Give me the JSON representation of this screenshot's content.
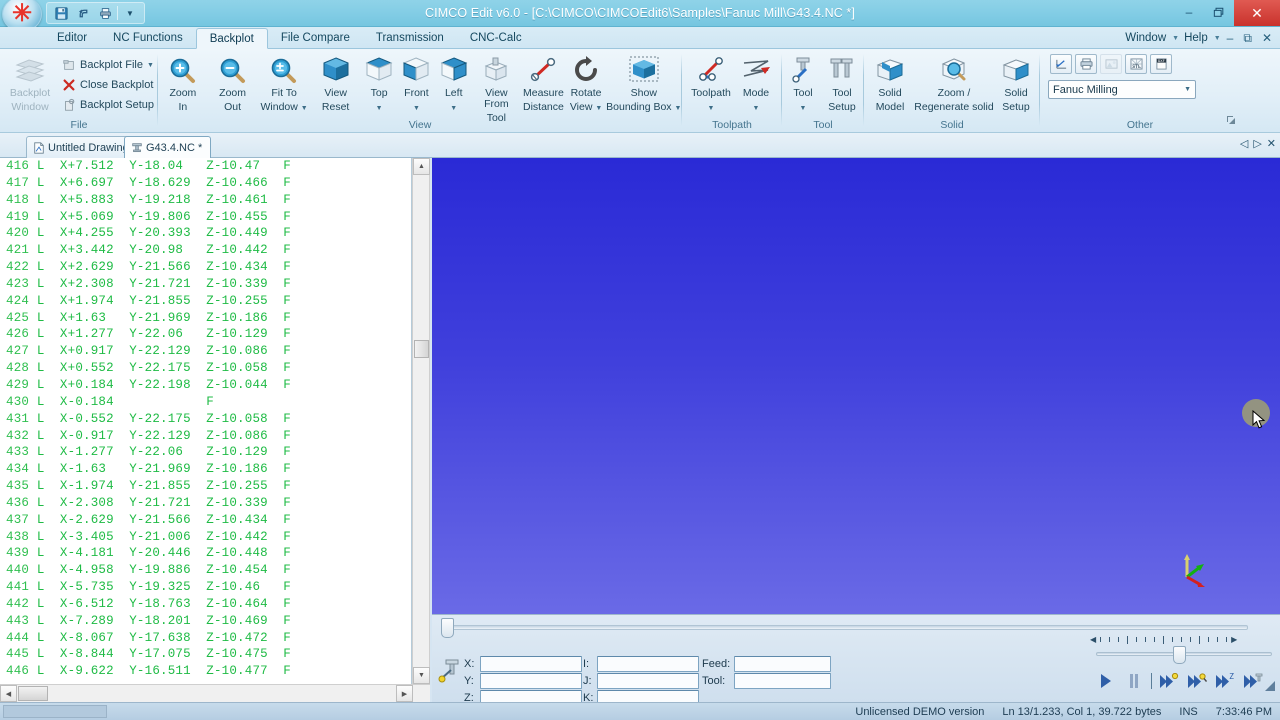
{
  "window": {
    "title": "CIMCO Edit v6.0 - [C:\\CIMCO\\CIMCOEdit6\\Samples\\Fanuc Mill\\G43.4.NC *]",
    "minimize": "–",
    "restore": "❐",
    "close": "✕",
    "quick_access": [
      "save-icon",
      "undo-icon",
      "print-icon",
      "customize-icon"
    ]
  },
  "ribbon_tabs": {
    "items": [
      {
        "label": "Editor",
        "active": false
      },
      {
        "label": "NC Functions",
        "active": false
      },
      {
        "label": "Backplot",
        "active": true
      },
      {
        "label": "File Compare",
        "active": false
      },
      {
        "label": "Transmission",
        "active": false
      },
      {
        "label": "CNC-Calc",
        "active": false
      }
    ],
    "right_menus": [
      {
        "label": "Window"
      },
      {
        "label": "Help"
      }
    ],
    "right_icons": [
      "minimize-icon",
      "restore-icon",
      "close-icon"
    ]
  },
  "ribbon": {
    "groups": [
      {
        "name": "File",
        "label": "File",
        "big": [
          {
            "label1": "Backplot",
            "label2": "Window",
            "icon": "backplot-window-icon",
            "disabled": true
          }
        ],
        "small": [
          {
            "label": "Backplot File",
            "icon": "backplot-file-icon",
            "has_caret": true
          },
          {
            "label": "Close Backplot",
            "icon": "close-backplot-icon",
            "has_caret": false
          },
          {
            "label": "Backplot Setup",
            "icon": "backplot-setup-icon",
            "has_caret": false
          }
        ]
      },
      {
        "name": "View",
        "label": "View",
        "big": [
          {
            "label1": "Zoom",
            "label2": "In",
            "icon": "zoom-in-icon"
          },
          {
            "label1": "Zoom",
            "label2": "Out",
            "icon": "zoom-out-icon"
          },
          {
            "label1": "Fit To",
            "label2": "Window",
            "icon": "fit-to-window-icon",
            "has_caret": true
          },
          {
            "label1": "View",
            "label2": "Reset",
            "icon": "view-reset-icon"
          },
          {
            "label1": "Top",
            "label2": "",
            "icon": "top-view-icon",
            "has_caret": true
          },
          {
            "label1": "Front",
            "label2": "",
            "icon": "front-view-icon",
            "has_caret": true
          },
          {
            "label1": "Left",
            "label2": "",
            "icon": "left-view-icon",
            "has_caret": true
          },
          {
            "label1": "View From",
            "label2": "Tool",
            "icon": "view-from-tool-icon"
          },
          {
            "label1": "Measure",
            "label2": "Distance",
            "icon": "measure-distance-icon"
          },
          {
            "label1": "Rotate",
            "label2": "View",
            "icon": "rotate-view-icon",
            "has_caret": true
          },
          {
            "label1": "Show",
            "label2": "Bounding Box",
            "icon": "show-bounding-box-icon",
            "has_caret": true
          }
        ]
      },
      {
        "name": "Toolpath",
        "label": "Toolpath",
        "big": [
          {
            "label1": "Toolpath",
            "label2": "",
            "icon": "toolpath-icon",
            "has_caret": true
          },
          {
            "label1": "Mode",
            "label2": "",
            "icon": "mode-icon",
            "has_caret": true
          }
        ]
      },
      {
        "name": "Tool",
        "label": "Tool",
        "big": [
          {
            "label1": "Tool",
            "label2": "",
            "icon": "tool-icon",
            "has_caret": true
          },
          {
            "label1": "Tool",
            "label2": "Setup",
            "icon": "tool-setup-icon"
          }
        ]
      },
      {
        "name": "Solid",
        "label": "Solid",
        "big": [
          {
            "label1": "Solid",
            "label2": "Model",
            "icon": "solid-model-icon"
          },
          {
            "label1": "Zoom /",
            "label2": "Regenerate solid",
            "icon": "zoom-regenerate-solid-icon"
          },
          {
            "label1": "Solid",
            "label2": "Setup",
            "icon": "solid-setup-icon"
          }
        ]
      },
      {
        "name": "Other",
        "label": "Other",
        "icons": [
          "export-plot-icon",
          "print-plot-icon",
          "snapshot-icon",
          "stl-export-icon",
          "dxf-export-icon"
        ],
        "machine_select": "Fanuc Milling",
        "dialog_launcher": "dialog-launcher-icon"
      }
    ]
  },
  "doc_tabs": {
    "items": [
      {
        "label": "Untitled Drawing",
        "icon": "drawing-icon",
        "active": false
      },
      {
        "label": "G43.4.NC *",
        "icon": "nc-file-icon",
        "active": true
      }
    ],
    "nav": [
      "◁",
      "▷",
      "✕"
    ]
  },
  "editor": {
    "lines": [
      {
        "no": "416",
        "code": "L  X+7.512  Y-18.04   Z-10.47   F"
      },
      {
        "no": "417",
        "code": "L  X+6.697  Y-18.629  Z-10.466  F"
      },
      {
        "no": "418",
        "code": "L  X+5.883  Y-19.218  Z-10.461  F"
      },
      {
        "no": "419",
        "code": "L  X+5.069  Y-19.806  Z-10.455  F"
      },
      {
        "no": "420",
        "code": "L  X+4.255  Y-20.393  Z-10.449  F"
      },
      {
        "no": "421",
        "code": "L  X+3.442  Y-20.98   Z-10.442  F"
      },
      {
        "no": "422",
        "code": "L  X+2.629  Y-21.566  Z-10.434  F"
      },
      {
        "no": "423",
        "code": "L  X+2.308  Y-21.721  Z-10.339  F"
      },
      {
        "no": "424",
        "code": "L  X+1.974  Y-21.855  Z-10.255  F"
      },
      {
        "no": "425",
        "code": "L  X+1.63   Y-21.969  Z-10.186  F"
      },
      {
        "no": "426",
        "code": "L  X+1.277  Y-22.06   Z-10.129  F"
      },
      {
        "no": "427",
        "code": "L  X+0.917  Y-22.129  Z-10.086  F"
      },
      {
        "no": "428",
        "code": "L  X+0.552  Y-22.175  Z-10.058  F"
      },
      {
        "no": "429",
        "code": "L  X+0.184  Y-22.198  Z-10.044  F"
      },
      {
        "no": "430",
        "code": "L  X-0.184            F"
      },
      {
        "no": "431",
        "code": "L  X-0.552  Y-22.175  Z-10.058  F"
      },
      {
        "no": "432",
        "code": "L  X-0.917  Y-22.129  Z-10.086  F"
      },
      {
        "no": "433",
        "code": "L  X-1.277  Y-22.06   Z-10.129  F"
      },
      {
        "no": "434",
        "code": "L  X-1.63   Y-21.969  Z-10.186  F"
      },
      {
        "no": "435",
        "code": "L  X-1.974  Y-21.855  Z-10.255  F"
      },
      {
        "no": "436",
        "code": "L  X-2.308  Y-21.721  Z-10.339  F"
      },
      {
        "no": "437",
        "code": "L  X-2.629  Y-21.566  Z-10.434  F"
      },
      {
        "no": "438",
        "code": "L  X-3.405  Y-21.006  Z-10.442  F"
      },
      {
        "no": "439",
        "code": "L  X-4.181  Y-20.446  Z-10.448  F"
      },
      {
        "no": "440",
        "code": "L  X-4.958  Y-19.886  Z-10.454  F"
      },
      {
        "no": "441",
        "code": "L  X-5.735  Y-19.325  Z-10.46   F"
      },
      {
        "no": "442",
        "code": "L  X-6.512  Y-18.763  Z-10.464  F"
      },
      {
        "no": "443",
        "code": "L  X-7.289  Y-18.201  Z-10.469  F"
      },
      {
        "no": "444",
        "code": "L  X-8.067  Y-17.638  Z-10.472  F"
      },
      {
        "no": "445",
        "code": "L  X-8.844  Y-17.075  Z-10.475  F"
      },
      {
        "no": "446",
        "code": "L  X-9.622  Y-16.511  Z-10.477  F"
      }
    ],
    "text_color": "#1fbb45",
    "background": "#ffffff"
  },
  "viewport": {
    "gradient_top": "#2a2ad6",
    "gradient_bottom": "#6a6ae6",
    "tool_marker_color": "#9a9a78",
    "axis_x_color": "#d42020",
    "axis_y_color": "#14b014",
    "axis_z_color": "#d8d070"
  },
  "control_panel": {
    "fields": [
      {
        "label": "X:",
        "value": "",
        "name": "x-field"
      },
      {
        "label": "Y:",
        "value": "",
        "name": "y-field"
      },
      {
        "label": "Z:",
        "value": "",
        "name": "z-field"
      },
      {
        "label": "I:",
        "value": "",
        "name": "i-field"
      },
      {
        "label": "J:",
        "value": "",
        "name": "j-field"
      },
      {
        "label": "K:",
        "value": "",
        "name": "k-field"
      },
      {
        "label": "Feed:",
        "value": "",
        "name": "feed-field"
      },
      {
        "label": "Tool:",
        "value": "",
        "name": "tool-field"
      }
    ],
    "playback": [
      {
        "name": "play-button",
        "glyph": "▶"
      },
      {
        "name": "pause-button",
        "glyph": "❙❙"
      },
      {
        "name": "step-to-position-button",
        "glyph": "step-pos"
      },
      {
        "name": "step-to-search-button",
        "glyph": "step-search"
      },
      {
        "name": "step-to-z-button",
        "glyph": "step-z"
      },
      {
        "name": "step-to-tool-button",
        "glyph": "step-tool"
      }
    ]
  },
  "statusbar": {
    "license": "Unlicensed DEMO version",
    "position": "Ln 13/1.233, Col 1, 39.722 bytes",
    "insert_mode": "INS",
    "time": "7:33:46 PM"
  }
}
